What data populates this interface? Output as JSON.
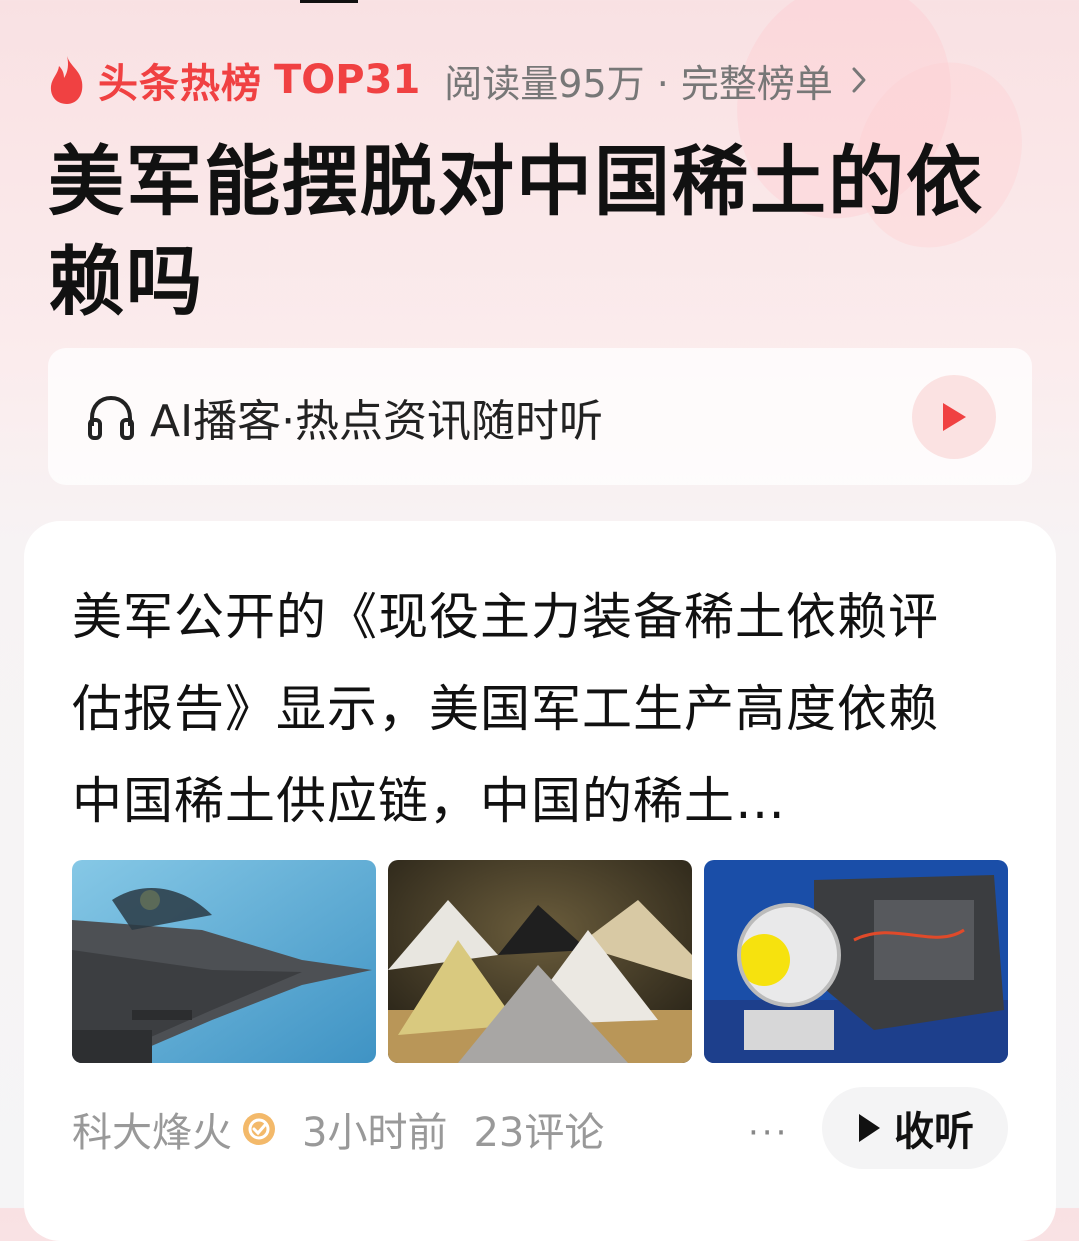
{
  "hot": {
    "label": "头条热榜",
    "rank": "TOP31",
    "meta": "阅读量95万 · 完整榜单",
    "accent": "#f04142"
  },
  "title": "美军能摆脱对中国稀土的依赖吗",
  "ai_card": {
    "text": "AI播客·热点资讯随时听",
    "icon": "headphones-icon",
    "play_icon": "play-icon"
  },
  "news": {
    "summary": "美军公开的《现役主力装备稀土依赖评估报告》显示，美国军工生产高度依赖中国稀土供应链，中国的稀土…",
    "images": [
      {
        "subject": "fighter-jet-photo"
      },
      {
        "subject": "rare-earth-powder-photo"
      },
      {
        "subject": "jet-engine-photo"
      }
    ],
    "author": "科大烽火",
    "time": "3小时前",
    "comments": "23评论",
    "more": "···",
    "listen_label": "收听"
  }
}
